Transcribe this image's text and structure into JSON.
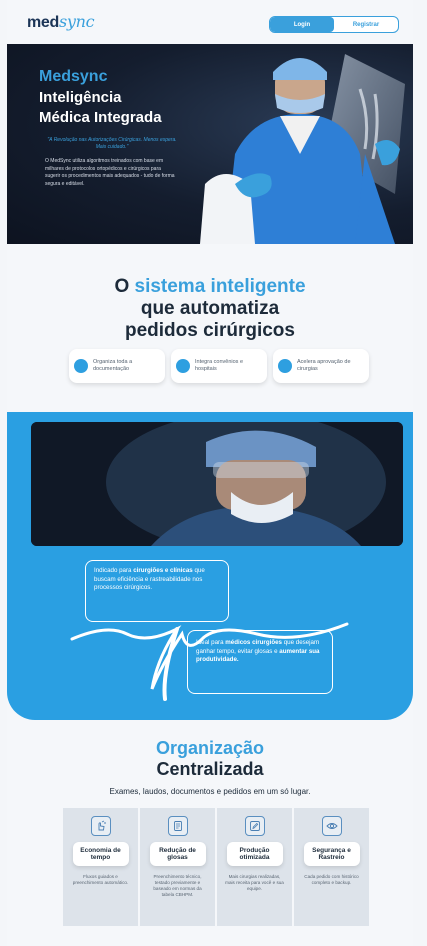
{
  "header": {
    "logo_prefix": "med",
    "logo_suffix": "sync",
    "login_label": "Login",
    "register_label": "Registrar"
  },
  "hero": {
    "brand": "Medsync",
    "headline_line1": "Inteligência",
    "headline_line2": "Médica Integrada",
    "quote": "\"A Revolução nas Autorizações Cirúrgicas. Menos espera. Mais cuidado.\"",
    "description": "O MedSync utiliza algoritmos treinados com base em milhares de protocolos ortopédicos e cirúrgicos para sugerir os procedimentos mais adequados - tudo de forma segura e editável."
  },
  "intro": {
    "title_prefix": "O ",
    "title_highlight": "sistema inteligente",
    "title_line2": "que automatiza",
    "title_line3": "pedidos cirúrgicos",
    "chips": [
      {
        "label": "Organiza toda a documentação"
      },
      {
        "label": "Integra convênios e hospitais"
      },
      {
        "label": "Acelera aprovação de cirurgias"
      }
    ]
  },
  "audience": {
    "card1_pre": "Indicado para ",
    "card1_bold": "cirurgiões e clínicas",
    "card1_post": " que buscam eficiência e rastreabilidade nos processos cirúrgicos.",
    "card2_pre": "Ideal para ",
    "card2_bold1": "médicos cirurgiões",
    "card2_mid": " que desejam ganhar tempo, evitar glosas e ",
    "card2_bold2": "aumentar sua produtividade."
  },
  "organization": {
    "title_highlight": "Organização",
    "title_line2": "Centralizada",
    "subtitle": "Exames, laudos, documentos e pedidos em um só lugar.",
    "features": [
      {
        "icon": "touch-icon",
        "title": "Economia de tempo",
        "desc": "Fluxos guiados e preenchimento automático."
      },
      {
        "icon": "document-icon",
        "title": "Redução de glosas",
        "desc": "Preenchimento técnico, testado previamente e baseado em normas da tabela CBHPM."
      },
      {
        "icon": "edit-icon",
        "title": "Produção otimizada",
        "desc": "Mais cirurgias realizadas, mais receita para você e sua equipe."
      },
      {
        "icon": "eye-icon",
        "title": "Segurança e Rastreio",
        "desc": "Cada pedido com histórico completo e backup."
      }
    ]
  },
  "colors": {
    "accent": "#3aa0dc",
    "blue_section": "#2a9fe2",
    "dark": "#1d2b3a"
  }
}
